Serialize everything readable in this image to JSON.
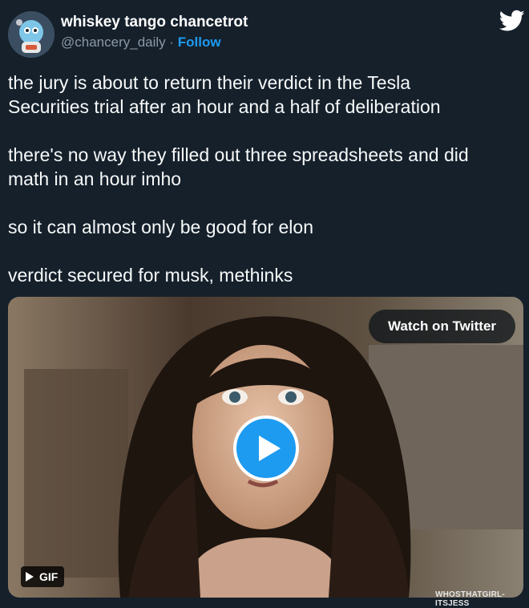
{
  "user": {
    "display_name": "whiskey tango chancetrot",
    "handle": "@chancery_daily",
    "separator": " · ",
    "follow_label": "Follow",
    "avatar_icon": "cartoon-character-avatar"
  },
  "brand_icon": "twitter-bird-icon",
  "tweet": {
    "paragraphs": [
      "the jury is about to return their verdict in the Tesla\nSecurities trial after an hour and a half of deliberation",
      "there's no way they filled out three spreadsheets and did\nmath in an hour imho",
      "so it can almost only be good for elon",
      "verdict secured for musk, methinks"
    ]
  },
  "media": {
    "watch_label": "Watch on Twitter",
    "gif_label": "GIF",
    "watermark": "WHOSTHATGIRL-ITSJESS"
  },
  "colors": {
    "background": "#15202b",
    "accent": "#1d9bf0",
    "secondary_text": "#8b98a5"
  }
}
